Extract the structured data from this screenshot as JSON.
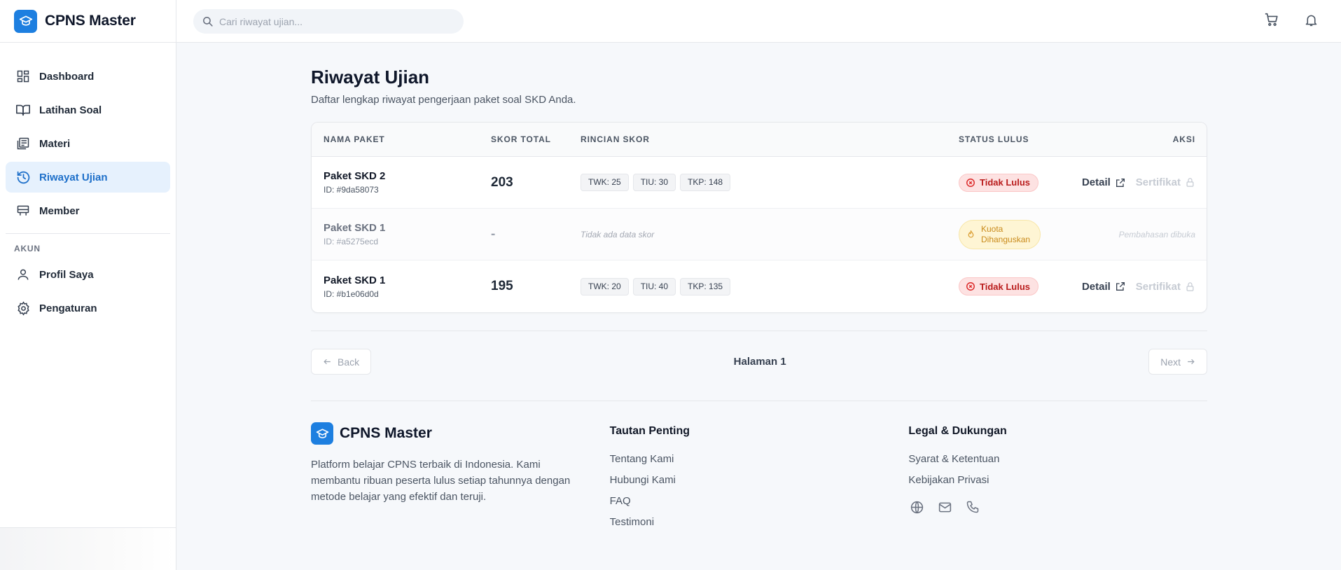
{
  "app": {
    "brand": "CPNS Master",
    "accent": "#1d7fe0"
  },
  "sidebar": {
    "items": [
      {
        "label": "Dashboard",
        "icon": "dashboard-icon"
      },
      {
        "label": "Latihan Soal",
        "icon": "book-icon"
      },
      {
        "label": "Materi",
        "icon": "document-icon"
      },
      {
        "label": "Riwayat Ujian",
        "icon": "history-icon",
        "active": true
      },
      {
        "label": "Member",
        "icon": "member-icon"
      }
    ],
    "section_label": "AKUN",
    "account_items": [
      {
        "label": "Profil Saya",
        "icon": "user-icon"
      },
      {
        "label": "Pengaturan",
        "icon": "gear-icon"
      }
    ]
  },
  "topbar": {
    "search_placeholder": "Cari riwayat ujian..."
  },
  "page": {
    "title": "Riwayat Ujian",
    "subtitle": "Daftar lengkap riwayat pengerjaan paket soal SKD Anda."
  },
  "table": {
    "headers": [
      "NAMA PAKET",
      "SKOR TOTAL",
      "RINCIAN SKOR",
      "STATUS LULUS",
      "AKSI"
    ],
    "rows": [
      {
        "name": "Paket SKD 2",
        "id": "ID: #9da58073",
        "score": "203",
        "chips": [
          "TWK: 25",
          "TIU: 30",
          "TKP: 148"
        ],
        "status": "Tidak Lulus",
        "detail": "Detail",
        "certificate": "Sertifikat"
      },
      {
        "name": "Paket SKD 1",
        "id": "ID: #a5275ecd",
        "score": "-",
        "no_score": "Tidak ada data skor",
        "status": "Kuota Dihanguskan",
        "status_line1": "Kuota",
        "status_line2": "Dihanguskan",
        "action_note": "Pembahasan dibuka"
      },
      {
        "name": "Paket SKD 1",
        "id": "ID: #b1e06d0d",
        "score": "195",
        "chips": [
          "TWK: 20",
          "TIU: 40",
          "TKP: 135"
        ],
        "status": "Tidak Lulus",
        "detail": "Detail",
        "certificate": "Sertifikat"
      }
    ]
  },
  "pagination": {
    "back": "Back",
    "label": "Halaman 1",
    "next": "Next"
  },
  "footer": {
    "brand": "CPNS Master",
    "description": "Platform belajar CPNS terbaik di Indonesia. Kami membantu ribuan peserta lulus setiap tahunnya dengan metode belajar yang efektif dan teruji.",
    "links_title": "Tautan Penting",
    "links": [
      "Tentang Kami",
      "Hubungi Kami",
      "FAQ",
      "Testimoni"
    ],
    "legal_title": "Legal & Dukungan",
    "legal": [
      "Syarat & Ketentuan",
      "Kebijakan Privasi"
    ],
    "socials": [
      "globe-icon",
      "mail-icon",
      "phone-icon"
    ]
  }
}
